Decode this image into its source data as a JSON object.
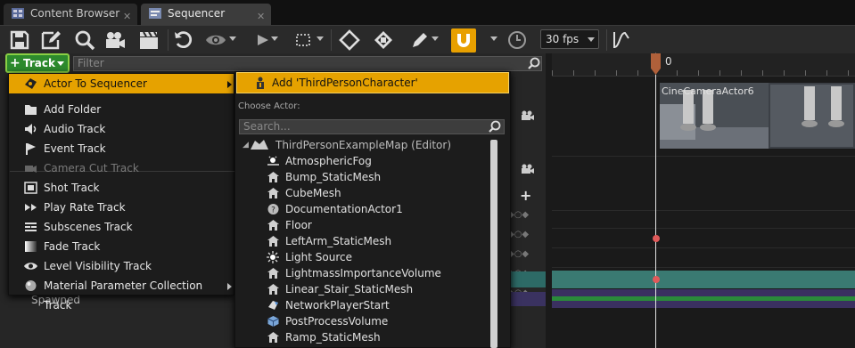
{
  "tabs": [
    {
      "label": "Content Browser",
      "icon": "content-browser-icon"
    },
    {
      "label": "Sequencer",
      "icon": "sequencer-icon"
    }
  ],
  "toolbar": {
    "fps": "30 fps",
    "colors": {
      "snap": "#e8a000"
    }
  },
  "track_button": {
    "label": "Track"
  },
  "filter": {
    "placeholder": "Filter"
  },
  "track_menu": {
    "items": [
      {
        "label": "Actor To Sequencer",
        "icon": "actor-icon",
        "highlighted": true,
        "submenu": true
      },
      {
        "label": "Add Folder",
        "icon": "folder-icon"
      },
      {
        "label": "Audio Track",
        "icon": "audio-icon"
      },
      {
        "label": "Event Track",
        "icon": "event-flag-icon"
      },
      {
        "label": "Camera Cut Track",
        "icon": "camera-cut-icon",
        "disabled": true
      },
      {
        "label": "Shot Track",
        "icon": "shot-icon"
      },
      {
        "label": "Play Rate Track",
        "icon": "play-rate-icon"
      },
      {
        "label": "Subscenes Track",
        "icon": "subscenes-icon"
      },
      {
        "label": "Fade Track",
        "icon": "fade-icon"
      },
      {
        "label": "Level Visibility Track",
        "icon": "eye-icon"
      },
      {
        "label": "Material Parameter Collection Track",
        "icon": "material-icon",
        "submenu": true
      }
    ]
  },
  "actor_menu": {
    "add_label": "Add 'ThirdPersonCharacter'",
    "choose_label": "Choose Actor:",
    "search_placeholder": "Search...",
    "map": "ThirdPersonExampleMap (Editor)",
    "actors": [
      {
        "label": "AtmosphericFog",
        "icon": "fog-icon"
      },
      {
        "label": "Bump_StaticMesh",
        "icon": "static-mesh-icon"
      },
      {
        "label": "CubeMesh",
        "icon": "static-mesh-icon"
      },
      {
        "label": "DocumentationActor1",
        "icon": "help-icon"
      },
      {
        "label": "Floor",
        "icon": "static-mesh-icon"
      },
      {
        "label": "LeftArm_StaticMesh",
        "icon": "static-mesh-icon"
      },
      {
        "label": "Light Source",
        "icon": "light-icon"
      },
      {
        "label": "LightmassImportanceVolume",
        "icon": "volume-icon"
      },
      {
        "label": "Linear_Stair_StaticMesh",
        "icon": "static-mesh-icon"
      },
      {
        "label": "NetworkPlayerStart",
        "icon": "player-start-icon"
      },
      {
        "label": "PostProcessVolume",
        "icon": "volume-cube-icon"
      },
      {
        "label": "Ramp_StaticMesh",
        "icon": "static-mesh-icon"
      }
    ]
  },
  "tracks": {
    "spawned_label": "Spawned"
  },
  "timeline": {
    "current_frame": "0",
    "camera_label": "CineCameraActor6"
  }
}
